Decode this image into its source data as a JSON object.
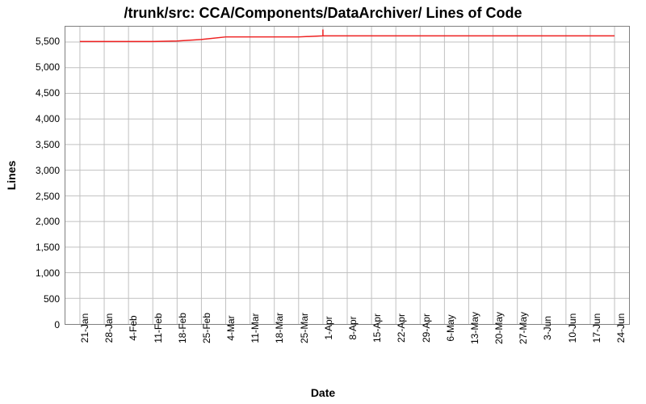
{
  "title": "/trunk/src: CCA/Components/DataArchiver/ Lines of Code",
  "xlabel": "Date",
  "ylabel": "Lines",
  "chart_data": {
    "type": "line",
    "title": "/trunk/src: CCA/Components/DataArchiver/ Lines of Code",
    "xlabel": "Date",
    "ylabel": "Lines",
    "ylim": [
      0,
      5800
    ],
    "y_ticks": [
      0,
      500,
      1000,
      1500,
      2000,
      2500,
      3000,
      3500,
      4000,
      4500,
      5000,
      5500
    ],
    "y_tick_labels": [
      "0",
      "500",
      "1,000",
      "1,500",
      "2,000",
      "2,500",
      "3,000",
      "3,500",
      "4,000",
      "4,500",
      "5,000",
      "5,500"
    ],
    "categories": [
      "21-Jan",
      "28-Jan",
      "4-Feb",
      "11-Feb",
      "18-Feb",
      "25-Feb",
      "4-Mar",
      "11-Mar",
      "18-Mar",
      "25-Mar",
      "1-Apr",
      "8-Apr",
      "15-Apr",
      "22-Apr",
      "29-Apr",
      "6-May",
      "13-May",
      "20-May",
      "27-May",
      "3-Jun",
      "10-Jun",
      "17-Jun",
      "24-Jun"
    ],
    "series": [
      {
        "name": "Lines of Code",
        "color": "#ee2020",
        "values": [
          5510,
          5510,
          5510,
          5510,
          5520,
          5550,
          5600,
          5600,
          5600,
          5600,
          5620,
          5620,
          5620,
          5620,
          5620,
          5620,
          5620,
          5620,
          5620,
          5620,
          5620,
          5620,
          5620
        ]
      }
    ],
    "annotations": [
      {
        "category": "1-Apr",
        "kind": "spike"
      }
    ]
  }
}
